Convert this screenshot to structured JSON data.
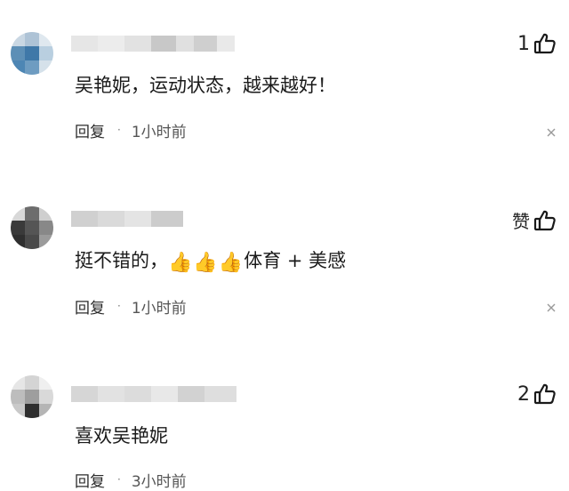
{
  "comments": [
    {
      "text": "吴艳妮，运动状态，越来越好！",
      "likes": "1",
      "reply_label": "回复",
      "separator": "·",
      "time": "1小时前"
    },
    {
      "text_before": "挺不错的，",
      "emoji": [
        "👍",
        "👍",
        "👍"
      ],
      "text_after": "体育 + 美感",
      "likes": "赞",
      "reply_label": "回复",
      "separator": "·",
      "time": "1小时前"
    },
    {
      "text": "喜欢吴艳妮",
      "likes": "2",
      "reply_label": "回复",
      "separator": "·",
      "time": "3小时前"
    }
  ],
  "icons": {
    "like": "thumbs-up-icon",
    "close": "close-icon"
  }
}
